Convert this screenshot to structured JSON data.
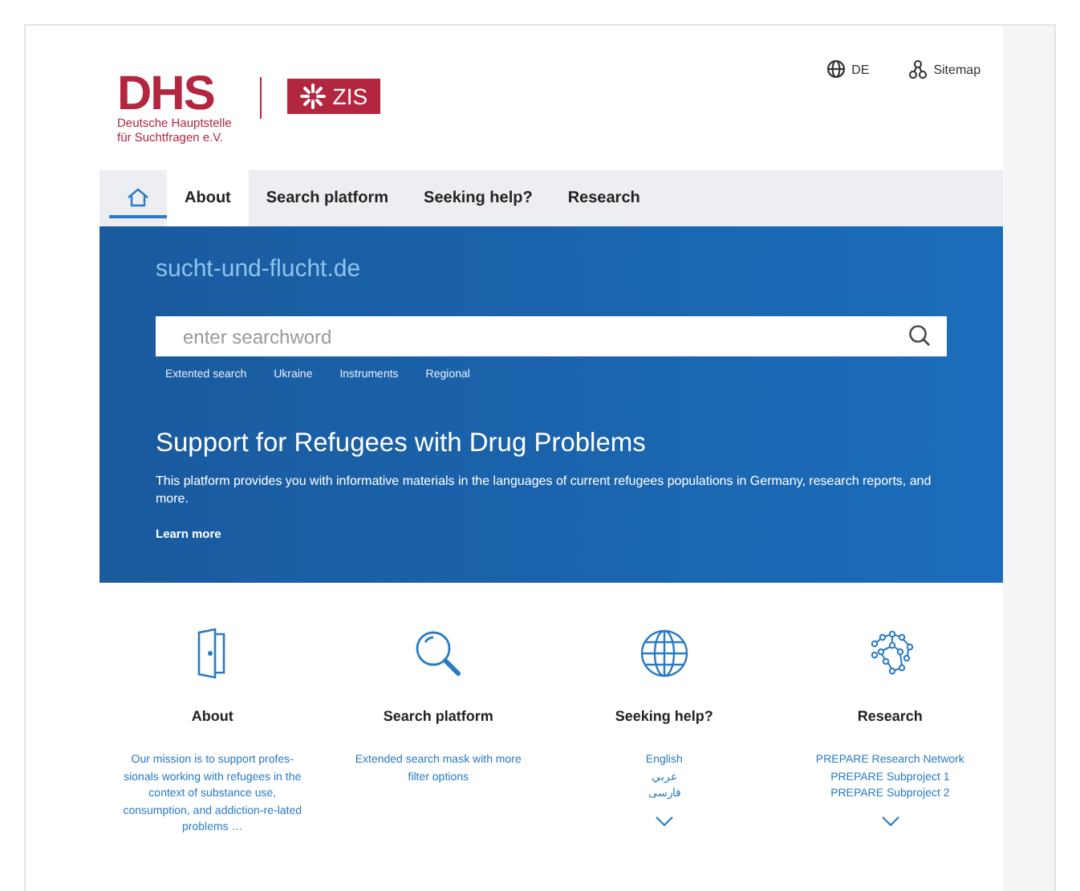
{
  "header": {
    "logo_caption": [
      "Deutsche Hauptstelle",
      "für Suchtfragen e.V."
    ],
    "logo_letters": "DHS",
    "partner_logo": "ZIS",
    "links": [
      {
        "kind": "language",
        "label": "DE"
      },
      {
        "kind": "sitemap",
        "label": "Sitemap"
      }
    ]
  },
  "tabs": [
    {
      "kind": "home",
      "selected": false,
      "active": true
    },
    {
      "kind": "text",
      "label": "About",
      "selected": true,
      "active": false
    },
    {
      "kind": "text",
      "label": "Search platform",
      "selected": false,
      "active": false
    },
    {
      "kind": "text",
      "label": "Seeking help?",
      "selected": false,
      "active": false
    },
    {
      "kind": "text",
      "label": "Research",
      "selected": false,
      "active": false
    }
  ],
  "hero": {
    "site_name": "sucht-und-flucht.de",
    "search": {
      "placeholder": "enter searchword"
    },
    "quick_links": [
      "Extented search",
      "Ukraine",
      "Instruments",
      "Regional"
    ],
    "heading": "Support for Refugees with Drug Problems",
    "text": "This platform provides you with informative materials in the  languages of current refugees populations in Germany, research reports, and more.",
    "link": "Learn more"
  },
  "cards": [
    {
      "kind": "text",
      "title": "About",
      "lines": [
        "Our mission is to support profes-sionals working with refugees in the context of substance use, consumption, and addiction-re-lated problems …"
      ]
    },
    {
      "kind": "text",
      "title": "Search platform",
      "lines": [
        "Extended search mask with more filter options"
      ]
    },
    {
      "kind": "links",
      "title": "Seeking help?",
      "lines": [
        "English",
        "عربي",
        "فارسی"
      ]
    },
    {
      "kind": "links",
      "title": "Research",
      "lines": [
        "PREPARE Research Network",
        "PREPARE Subproject 1",
        "PREPARE Subproject 2"
      ]
    }
  ]
}
